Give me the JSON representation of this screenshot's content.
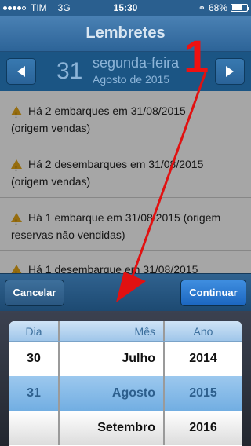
{
  "status": {
    "carrier": "TIM",
    "network": "3G",
    "time": "15:30",
    "battery": "68%",
    "battery_level": 0.68
  },
  "nav": {
    "title": "Lembretes"
  },
  "date_bar": {
    "day": "31",
    "weekday": "segunda-feira",
    "month_year": "Agosto de 2015",
    "prev_icon": "left-arrow-icon",
    "next_icon": "right-arrow-icon"
  },
  "reminders": [
    {
      "line1": "Há 2 embarques em 31/08/2015",
      "line2": "(origem vendas)"
    },
    {
      "line1": "Há 2 desembarques em 31/08/2015",
      "line2": "(origem vendas)"
    },
    {
      "line1": "Há 1 embarque em 31/08/2015 (origem",
      "line2": "reservas não vendidas)"
    },
    {
      "line1": "Há 1 desembarque em 31/08/2015",
      "line2": ""
    }
  ],
  "toolbar": {
    "cancel_label": "Cancelar",
    "continue_label": "Continuar"
  },
  "picker": {
    "headers": {
      "day": "Dia",
      "month": "Mês",
      "year": "Ano"
    },
    "rows": [
      {
        "day": "30",
        "month": "Julho",
        "year": "2014"
      },
      {
        "day": "31",
        "month": "Agosto",
        "year": "2015"
      },
      {
        "day": "",
        "month": "Setembro",
        "year": "2016"
      }
    ]
  },
  "annotation": {
    "number": "1",
    "color": "#e11111"
  },
  "colors": {
    "navbar": "#2d6498",
    "accent": "#1b66c0"
  }
}
